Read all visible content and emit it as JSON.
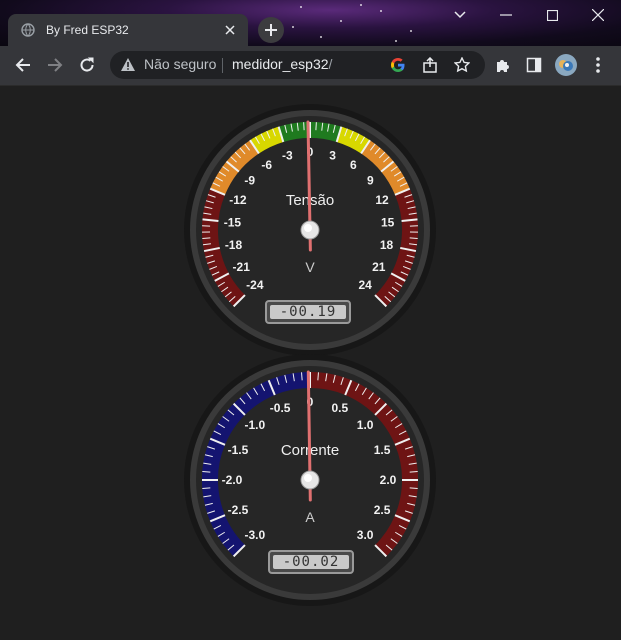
{
  "browser": {
    "tab_title": "By Fred ESP32",
    "security_label": "Não seguro",
    "url": "medidor_esp32",
    "url_suffix": "/"
  },
  "colors": {
    "gauge_face": "#2a2a2a",
    "needle": "#e07070",
    "green_zone": "#1f7a1f",
    "yellow_zone": "#d8d800",
    "orange_zone": "#e08a2a",
    "red_zone": "#6e1414",
    "blue_zone": "#141470"
  },
  "gauges": [
    {
      "title": "Tensão",
      "units": "V",
      "min": -24,
      "max": 24,
      "value": -0.19,
      "display": "-00.19",
      "labels": [
        "-24",
        "-21",
        "-18",
        "-15",
        "-12",
        "-9",
        "-6",
        "-3",
        "0",
        "3",
        "6",
        "9",
        "12",
        "15",
        "18",
        "21",
        "24"
      ],
      "label_values": [
        -24,
        -21,
        -18,
        -15,
        -12,
        -9,
        -6,
        -3,
        0,
        3,
        6,
        9,
        12,
        15,
        18,
        21,
        24
      ],
      "highlights": [
        {
          "from": -24,
          "to": -12,
          "color": "#6e1414"
        },
        {
          "from": -12,
          "to": -6,
          "color": "#e08a2a"
        },
        {
          "from": -6,
          "to": -3,
          "color": "#d8d800"
        },
        {
          "from": -3,
          "to": 3,
          "color": "#1f7a1f"
        },
        {
          "from": 3,
          "to": 6,
          "color": "#d8d800"
        },
        {
          "from": 6,
          "to": 12,
          "color": "#e08a2a"
        },
        {
          "from": 12,
          "to": 24,
          "color": "#6e1414"
        }
      ]
    },
    {
      "title": "Corrente",
      "units": "A",
      "min": -3,
      "max": 3,
      "value": -0.02,
      "display": "-00.02",
      "labels": [
        "-3.0",
        "-2.5",
        "-2.0",
        "-1.5",
        "-1.0",
        "-0.5",
        "0",
        "0.5",
        "1.0",
        "1.5",
        "2.0",
        "2.5",
        "3.0"
      ],
      "label_values": [
        -3,
        -2.5,
        -2,
        -1.5,
        -1,
        -0.5,
        0,
        0.5,
        1,
        1.5,
        2,
        2.5,
        3
      ],
      "highlights": [
        {
          "from": -3,
          "to": 0,
          "color": "#141470"
        },
        {
          "from": 0,
          "to": 3,
          "color": "#6e1414"
        }
      ]
    }
  ]
}
